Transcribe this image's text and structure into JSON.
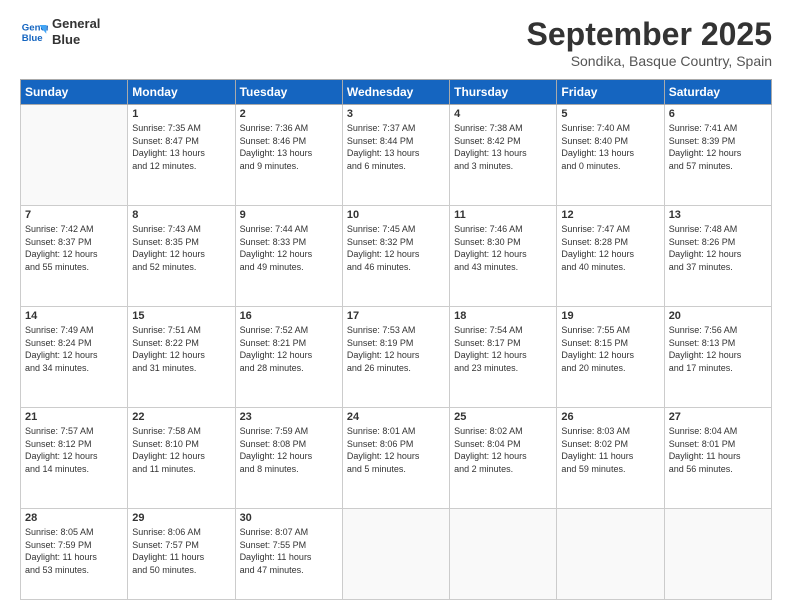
{
  "logo": {
    "line1": "General",
    "line2": "Blue"
  },
  "title": "September 2025",
  "location": "Sondika, Basque Country, Spain",
  "headers": [
    "Sunday",
    "Monday",
    "Tuesday",
    "Wednesday",
    "Thursday",
    "Friday",
    "Saturday"
  ],
  "weeks": [
    [
      {
        "day": "",
        "info": ""
      },
      {
        "day": "1",
        "info": "Sunrise: 7:35 AM\nSunset: 8:47 PM\nDaylight: 13 hours\nand 12 minutes."
      },
      {
        "day": "2",
        "info": "Sunrise: 7:36 AM\nSunset: 8:46 PM\nDaylight: 13 hours\nand 9 minutes."
      },
      {
        "day": "3",
        "info": "Sunrise: 7:37 AM\nSunset: 8:44 PM\nDaylight: 13 hours\nand 6 minutes."
      },
      {
        "day": "4",
        "info": "Sunrise: 7:38 AM\nSunset: 8:42 PM\nDaylight: 13 hours\nand 3 minutes."
      },
      {
        "day": "5",
        "info": "Sunrise: 7:40 AM\nSunset: 8:40 PM\nDaylight: 13 hours\nand 0 minutes."
      },
      {
        "day": "6",
        "info": "Sunrise: 7:41 AM\nSunset: 8:39 PM\nDaylight: 12 hours\nand 57 minutes."
      }
    ],
    [
      {
        "day": "7",
        "info": "Sunrise: 7:42 AM\nSunset: 8:37 PM\nDaylight: 12 hours\nand 55 minutes."
      },
      {
        "day": "8",
        "info": "Sunrise: 7:43 AM\nSunset: 8:35 PM\nDaylight: 12 hours\nand 52 minutes."
      },
      {
        "day": "9",
        "info": "Sunrise: 7:44 AM\nSunset: 8:33 PM\nDaylight: 12 hours\nand 49 minutes."
      },
      {
        "day": "10",
        "info": "Sunrise: 7:45 AM\nSunset: 8:32 PM\nDaylight: 12 hours\nand 46 minutes."
      },
      {
        "day": "11",
        "info": "Sunrise: 7:46 AM\nSunset: 8:30 PM\nDaylight: 12 hours\nand 43 minutes."
      },
      {
        "day": "12",
        "info": "Sunrise: 7:47 AM\nSunset: 8:28 PM\nDaylight: 12 hours\nand 40 minutes."
      },
      {
        "day": "13",
        "info": "Sunrise: 7:48 AM\nSunset: 8:26 PM\nDaylight: 12 hours\nand 37 minutes."
      }
    ],
    [
      {
        "day": "14",
        "info": "Sunrise: 7:49 AM\nSunset: 8:24 PM\nDaylight: 12 hours\nand 34 minutes."
      },
      {
        "day": "15",
        "info": "Sunrise: 7:51 AM\nSunset: 8:22 PM\nDaylight: 12 hours\nand 31 minutes."
      },
      {
        "day": "16",
        "info": "Sunrise: 7:52 AM\nSunset: 8:21 PM\nDaylight: 12 hours\nand 28 minutes."
      },
      {
        "day": "17",
        "info": "Sunrise: 7:53 AM\nSunset: 8:19 PM\nDaylight: 12 hours\nand 26 minutes."
      },
      {
        "day": "18",
        "info": "Sunrise: 7:54 AM\nSunset: 8:17 PM\nDaylight: 12 hours\nand 23 minutes."
      },
      {
        "day": "19",
        "info": "Sunrise: 7:55 AM\nSunset: 8:15 PM\nDaylight: 12 hours\nand 20 minutes."
      },
      {
        "day": "20",
        "info": "Sunrise: 7:56 AM\nSunset: 8:13 PM\nDaylight: 12 hours\nand 17 minutes."
      }
    ],
    [
      {
        "day": "21",
        "info": "Sunrise: 7:57 AM\nSunset: 8:12 PM\nDaylight: 12 hours\nand 14 minutes."
      },
      {
        "day": "22",
        "info": "Sunrise: 7:58 AM\nSunset: 8:10 PM\nDaylight: 12 hours\nand 11 minutes."
      },
      {
        "day": "23",
        "info": "Sunrise: 7:59 AM\nSunset: 8:08 PM\nDaylight: 12 hours\nand 8 minutes."
      },
      {
        "day": "24",
        "info": "Sunrise: 8:01 AM\nSunset: 8:06 PM\nDaylight: 12 hours\nand 5 minutes."
      },
      {
        "day": "25",
        "info": "Sunrise: 8:02 AM\nSunset: 8:04 PM\nDaylight: 12 hours\nand 2 minutes."
      },
      {
        "day": "26",
        "info": "Sunrise: 8:03 AM\nSunset: 8:02 PM\nDaylight: 11 hours\nand 59 minutes."
      },
      {
        "day": "27",
        "info": "Sunrise: 8:04 AM\nSunset: 8:01 PM\nDaylight: 11 hours\nand 56 minutes."
      }
    ],
    [
      {
        "day": "28",
        "info": "Sunrise: 8:05 AM\nSunset: 7:59 PM\nDaylight: 11 hours\nand 53 minutes."
      },
      {
        "day": "29",
        "info": "Sunrise: 8:06 AM\nSunset: 7:57 PM\nDaylight: 11 hours\nand 50 minutes."
      },
      {
        "day": "30",
        "info": "Sunrise: 8:07 AM\nSunset: 7:55 PM\nDaylight: 11 hours\nand 47 minutes."
      },
      {
        "day": "",
        "info": ""
      },
      {
        "day": "",
        "info": ""
      },
      {
        "day": "",
        "info": ""
      },
      {
        "day": "",
        "info": ""
      }
    ]
  ]
}
